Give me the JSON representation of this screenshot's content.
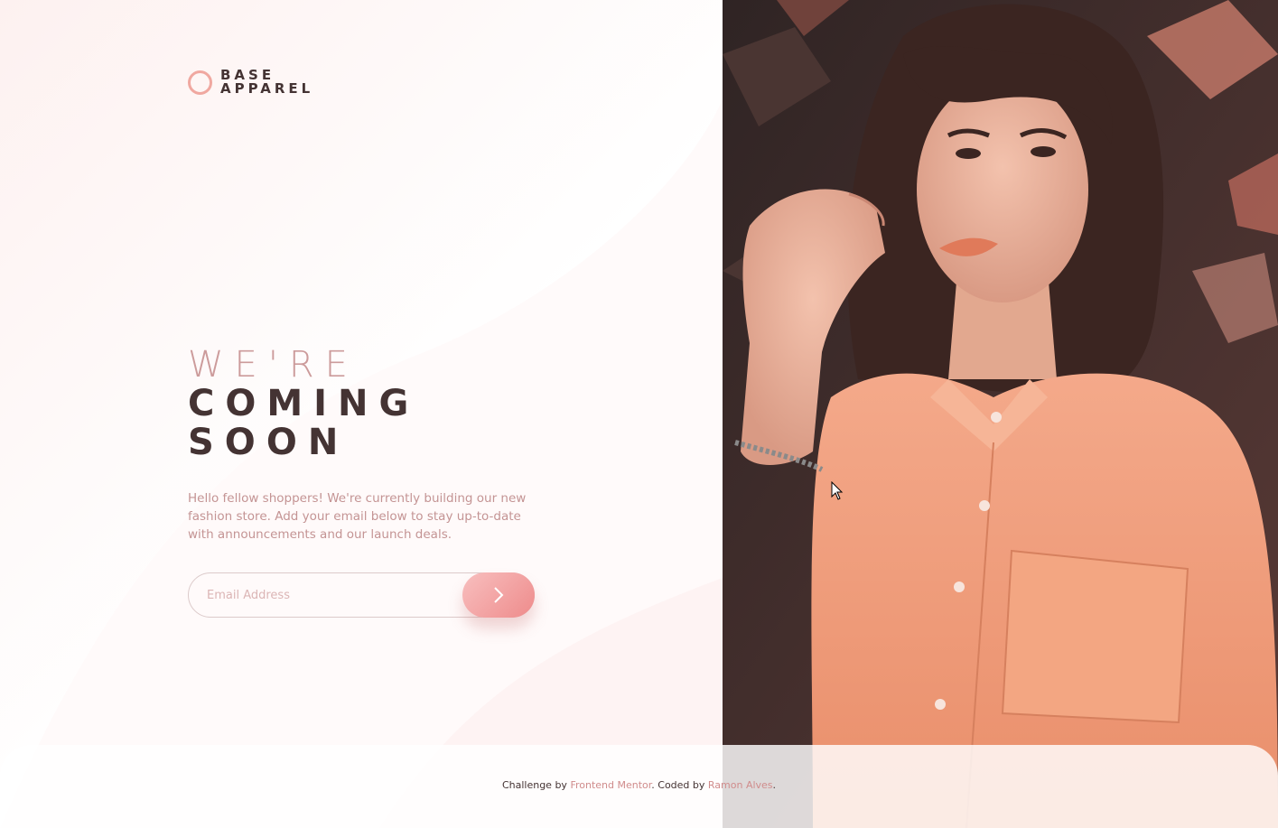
{
  "brand": {
    "line1": "BASE",
    "line2": "APPAREL",
    "accent_color": "#f0a8a0",
    "text_color": "#433333"
  },
  "headline": {
    "line1": "WE'RE",
    "line2": "COMING",
    "line3": "SOON"
  },
  "description": "Hello fellow shoppers! We're currently building our new fashion store. Add your email below to stay up-to-date with announcements and our launch deals.",
  "form": {
    "email_placeholder": "Email Address",
    "submit_icon": "chevron-right-icon"
  },
  "hero": {
    "subject": "hero-photo",
    "shirt_color": "#f0a07a"
  },
  "footer": {
    "prefix": "Challenge by",
    "link1": "Frontend Mentor",
    "middle": ". Coded by",
    "link2": "Ramon Alves",
    "suffix": "."
  }
}
